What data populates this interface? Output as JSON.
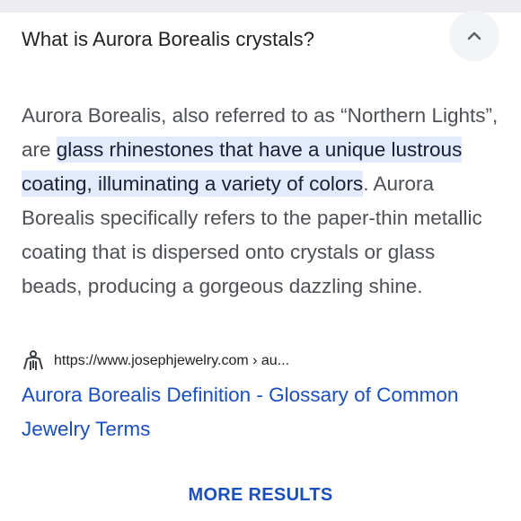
{
  "question": {
    "title": "What is Aurora Borealis crystals?",
    "toggle_icon": "chevron-up-icon"
  },
  "answer": {
    "text_before": "Aurora Borealis, also referred to as “Northern Lights”, are ",
    "highlight": "glass rhinestones that have a unique lustrous coating, illuminating a variety of colors",
    "text_after": ". Aurora Borealis specifically refers to the paper-thin metallic coating that is dispersed onto crystals or glass beads, producing a gorgeous dazzling shine."
  },
  "source": {
    "favicon": "jewelry-logo-icon",
    "url": "https://www.josephjewelry.com › au...",
    "link_title": "Aurora Borealis Definition - Glossary of Common Jewelry Terms"
  },
  "more_results_label": "MORE RESULTS",
  "colors": {
    "link": "#1a4fbf",
    "highlight_bg": "#e2eafb",
    "body_text": "#4d5156"
  }
}
